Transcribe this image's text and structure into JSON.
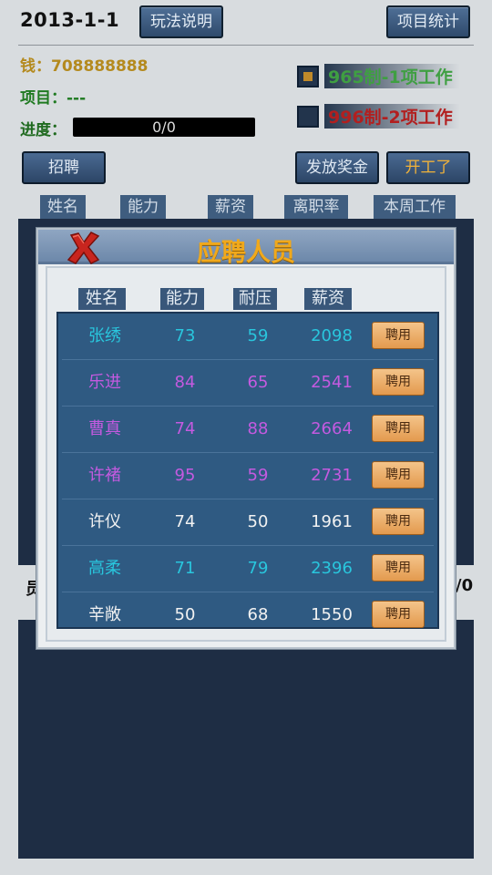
{
  "header": {
    "date": "2013-1-1",
    "rules_button": "玩法说明",
    "stats_button": "项目统计"
  },
  "status": {
    "money": "钱：708888888",
    "project": "项目：---",
    "progress_label": "进度：",
    "progress_value": "0/0"
  },
  "schedules": [
    {
      "label": "965制-1项工作",
      "checked": true,
      "color": "#3f9f42"
    },
    {
      "label": "996制-2项工作",
      "checked": false,
      "color": "#b21f1f"
    }
  ],
  "actions": {
    "hire": "招聘",
    "bonus": "发放奖金",
    "start": "开工了"
  },
  "staff_columns": [
    "姓名",
    "能力",
    "薪资",
    "离职率",
    "本周工作"
  ],
  "under_dialog": {
    "left_fragment": "员",
    "right_fragment": "/0"
  },
  "dialog": {
    "title": "应聘人员",
    "columns": [
      "姓名",
      "能力",
      "耐压",
      "薪资"
    ],
    "hire_label": "聘用",
    "candidates": [
      {
        "name": "张绣",
        "ability": "73",
        "stress": "59",
        "salary": "2098",
        "color": "#29c6dd"
      },
      {
        "name": "乐进",
        "ability": "84",
        "stress": "65",
        "salary": "2541",
        "color": "#c45ae0"
      },
      {
        "name": "曹真",
        "ability": "74",
        "stress": "88",
        "salary": "2664",
        "color": "#c45ae0"
      },
      {
        "name": "许褚",
        "ability": "95",
        "stress": "59",
        "salary": "2731",
        "color": "#c45ae0"
      },
      {
        "name": "许仪",
        "ability": "74",
        "stress": "50",
        "salary": "1961",
        "color": "#f2f2f2"
      },
      {
        "name": "高柔",
        "ability": "71",
        "stress": "79",
        "salary": "2396",
        "color": "#29c6dd"
      },
      {
        "name": "辛敞",
        "ability": "50",
        "stress": "68",
        "salary": "1550",
        "color": "#f2f2f2"
      }
    ]
  }
}
